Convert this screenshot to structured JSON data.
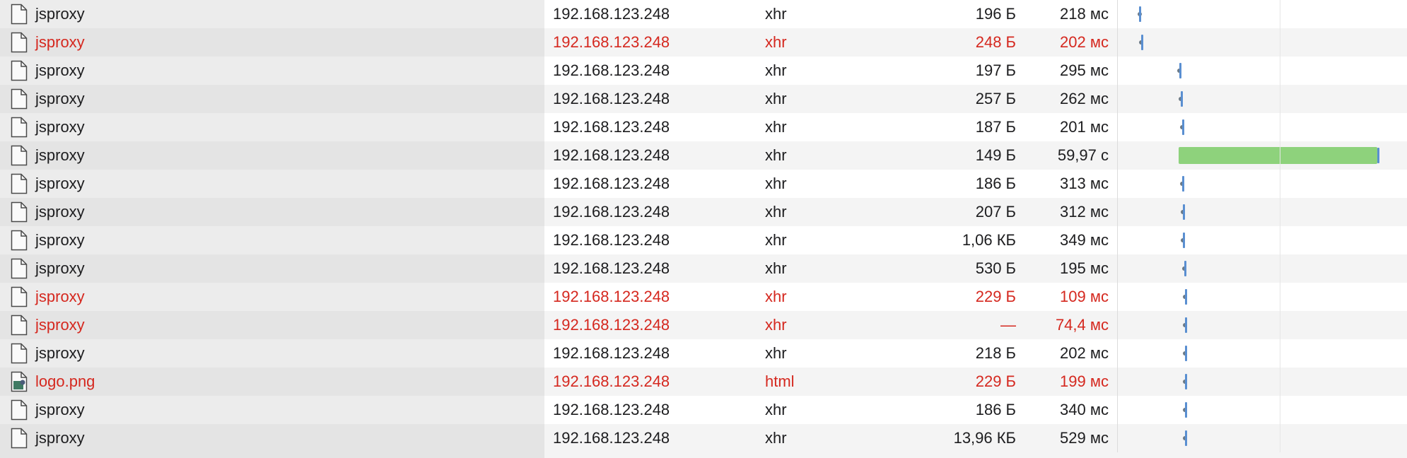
{
  "requests": [
    {
      "name": "jsproxy",
      "domain": "192.168.123.248",
      "type": "xhr",
      "size": "196 Б",
      "time": "218 мс",
      "error": false,
      "icon": "document-icon"
    },
    {
      "name": "jsproxy",
      "domain": "192.168.123.248",
      "type": "xhr",
      "size": "248 Б",
      "time": "202 мс",
      "error": true,
      "icon": "document-icon"
    },
    {
      "name": "jsproxy",
      "domain": "192.168.123.248",
      "type": "xhr",
      "size": "197 Б",
      "time": "295 мс",
      "error": false,
      "icon": "document-icon"
    },
    {
      "name": "jsproxy",
      "domain": "192.168.123.248",
      "type": "xhr",
      "size": "257 Б",
      "time": "262 мс",
      "error": false,
      "icon": "document-icon"
    },
    {
      "name": "jsproxy",
      "domain": "192.168.123.248",
      "type": "xhr",
      "size": "187 Б",
      "time": "201 мс",
      "error": false,
      "icon": "document-icon"
    },
    {
      "name": "jsproxy",
      "domain": "192.168.123.248",
      "type": "xhr",
      "size": "149 Б",
      "time": "59,97 с",
      "error": false,
      "icon": "document-icon"
    },
    {
      "name": "jsproxy",
      "domain": "192.168.123.248",
      "type": "xhr",
      "size": "186 Б",
      "time": "313 мс",
      "error": false,
      "icon": "document-icon"
    },
    {
      "name": "jsproxy",
      "domain": "192.168.123.248",
      "type": "xhr",
      "size": "207 Б",
      "time": "312 мс",
      "error": false,
      "icon": "document-icon"
    },
    {
      "name": "jsproxy",
      "domain": "192.168.123.248",
      "type": "xhr",
      "size": "1,06 КБ",
      "time": "349 мс",
      "error": false,
      "icon": "document-icon"
    },
    {
      "name": "jsproxy",
      "domain": "192.168.123.248",
      "type": "xhr",
      "size": "530 Б",
      "time": "195 мс",
      "error": false,
      "icon": "document-icon"
    },
    {
      "name": "jsproxy",
      "domain": "192.168.123.248",
      "type": "xhr",
      "size": "229 Б",
      "time": "109 мс",
      "error": true,
      "icon": "document-icon"
    },
    {
      "name": "jsproxy",
      "domain": "192.168.123.248",
      "type": "xhr",
      "size": "—",
      "time": "74,4 мс",
      "error": true,
      "icon": "document-icon"
    },
    {
      "name": "jsproxy",
      "domain": "192.168.123.248",
      "type": "xhr",
      "size": "218 Б",
      "time": "202 мс",
      "error": false,
      "icon": "document-icon"
    },
    {
      "name": "logo.png",
      "domain": "192.168.123.248",
      "type": "html",
      "size": "229 Б",
      "time": "199 мс",
      "error": true,
      "icon": "image-file-icon"
    },
    {
      "name": "jsproxy",
      "domain": "192.168.123.248",
      "type": "xhr",
      "size": "186 Б",
      "time": "340 мс",
      "error": false,
      "icon": "document-icon"
    },
    {
      "name": "jsproxy",
      "domain": "192.168.123.248",
      "type": "xhr",
      "size": "13,96 КБ",
      "time": "529 мс",
      "error": false,
      "icon": "document-icon"
    }
  ],
  "colors": {
    "error_text": "#d5281f",
    "normal_text": "#1d1d1f",
    "waterfall_marker": "#5a8fd1",
    "waterfall_bar": "#8ed27c"
  }
}
